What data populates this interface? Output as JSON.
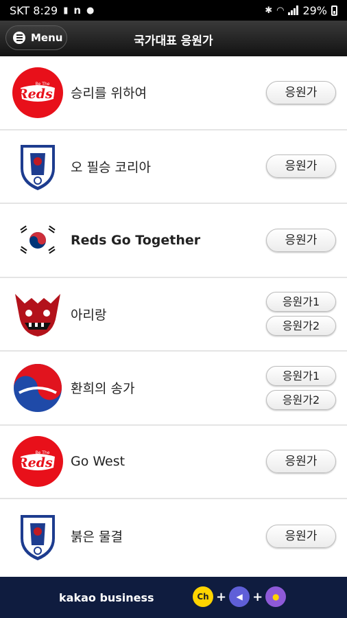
{
  "status_bar": {
    "carrier_time": "SKT 8:29",
    "battery_percent": "29%",
    "icons": [
      "notification-icon",
      "n-icon",
      "chat-icon",
      "bluetooth-icon",
      "wifi-icon",
      "signal-icon",
      "battery-icon"
    ]
  },
  "app_bar": {
    "menu_label": "Menu",
    "title": "국가대표 응원가"
  },
  "songs": [
    {
      "title": "승리를 위하여",
      "logo": "reds-logo",
      "buttons": [
        "응원가"
      ]
    },
    {
      "title": "오 필승 코리아",
      "logo": "kfa-crest",
      "buttons": [
        "응원가"
      ]
    },
    {
      "title": "Reds Go Together",
      "logo": "taegukgi",
      "buttons": [
        "응원가"
      ]
    },
    {
      "title": "아리랑",
      "logo": "red-devil-mask",
      "buttons": [
        "응원가1",
        "응원가2"
      ]
    },
    {
      "title": "환희의 송가",
      "logo": "taeguk-ball",
      "buttons": [
        "응원가1",
        "응원가2"
      ]
    },
    {
      "title": "Go West",
      "logo": "reds-logo",
      "buttons": [
        "응원가"
      ]
    },
    {
      "title": "붉은 물결",
      "logo": "kfa-crest",
      "buttons": [
        "응원가"
      ]
    }
  ],
  "footer": {
    "brand": "kakao business",
    "promo_icons": [
      "channel-icon",
      "speaker-icon",
      "profile-icon"
    ],
    "channel_text": "Ch",
    "colors": {
      "background": "#0f1c3f",
      "accent": "#ffd400"
    }
  },
  "colors": {
    "reds_red": "#e8101a",
    "header_dark": "#1c1c1c"
  }
}
